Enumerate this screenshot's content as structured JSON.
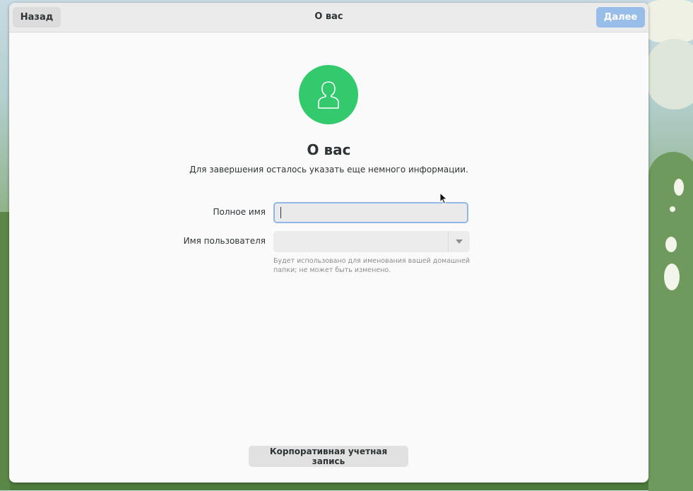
{
  "header": {
    "back_label": "Назад",
    "title": "О вас",
    "next_label": "Далее"
  },
  "main": {
    "avatar_icon": "user-avatar-icon",
    "heading": "О вас",
    "subtitle": "Для завершения осталось указать еще немного информации."
  },
  "form": {
    "fullname_label": "Полное имя",
    "fullname_value": "",
    "username_label": "Имя пользователя",
    "username_value": "",
    "username_hint": "Будет использовано для именования вашей домашней папки; не может быть изменено."
  },
  "footer": {
    "enterprise_label": "Корпоративная учетная запись"
  },
  "colors": {
    "accent": "#33c96d",
    "next_button_disabled": "#99bde9",
    "focus_ring": "#8fb7e7"
  }
}
